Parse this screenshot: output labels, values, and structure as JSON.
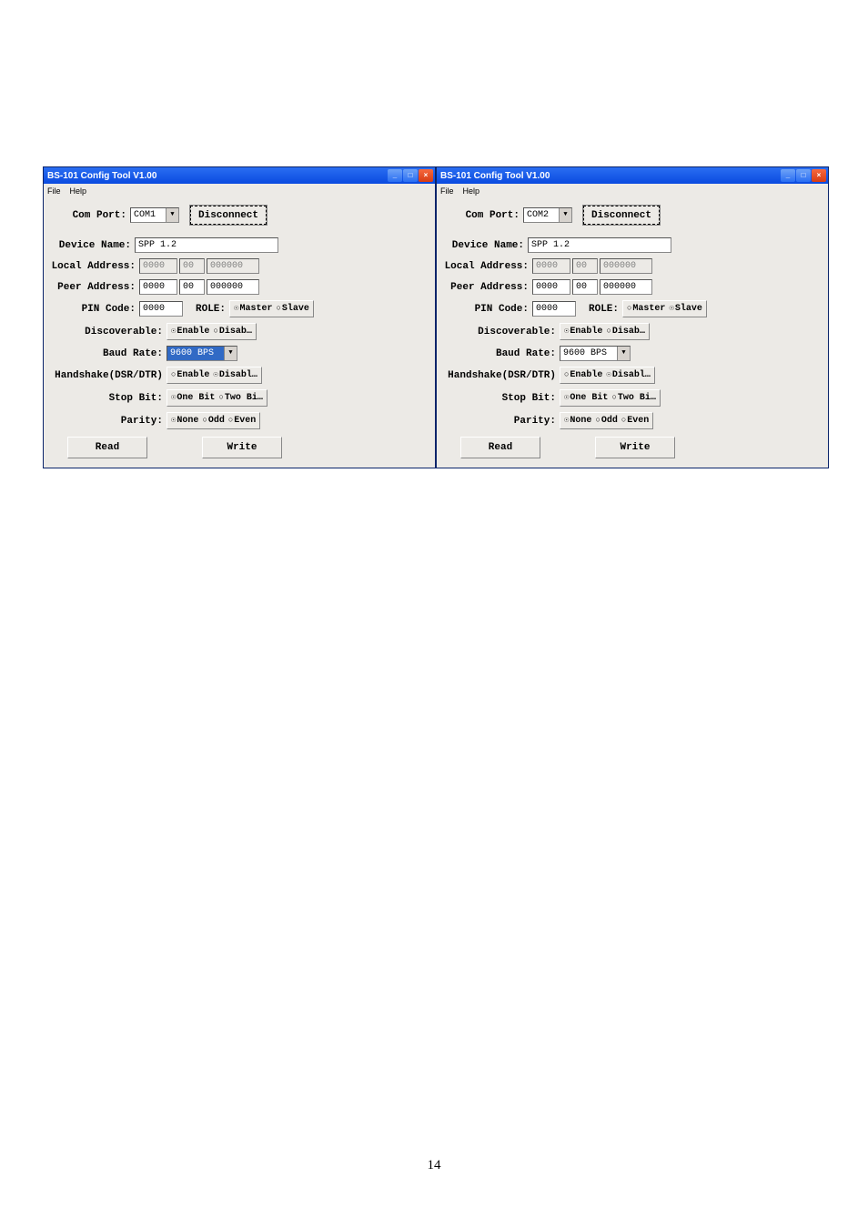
{
  "page_number": "14",
  "windows": [
    {
      "title": "BS-101 Config Tool V1.00",
      "menu": {
        "file": "File",
        "help": "Help"
      },
      "com_port": {
        "label": "Com Port:",
        "value": "COM1",
        "button": "Disconnect"
      },
      "device_name": {
        "label": "Device Name:",
        "value": "SPP 1.2"
      },
      "local_addr": {
        "label": "Local Address:",
        "a": "0000",
        "b": "00",
        "c": "000000"
      },
      "peer_addr": {
        "label": "Peer Address:",
        "a": "0000",
        "b": "00",
        "c": "000000"
      },
      "pin": {
        "label": "PIN Code:",
        "value": "0000"
      },
      "role": {
        "label": "ROLE:",
        "opt1": "Master",
        "opt2": "Slave",
        "selected": 1
      },
      "discoverable": {
        "label": "Discoverable:",
        "opt1": "Enable",
        "opt2": "Disab…",
        "selected": 1
      },
      "baud": {
        "label": "Baud Rate:",
        "value": "9600 BPS",
        "highlight": true
      },
      "handshake": {
        "label": "Handshake(DSR/DTR)",
        "opt1": "Enable",
        "opt2": "Disabl…",
        "selected": 2
      },
      "stopbit": {
        "label": "Stop Bit:",
        "opt1": "One Bit",
        "opt2": "Two Bi…",
        "selected": 1
      },
      "parity": {
        "label": "Parity:",
        "opt1": "None",
        "opt2": "Odd",
        "opt3": "Even",
        "selected": 1
      },
      "read_btn": "Read",
      "write_btn": "Write"
    },
    {
      "title": "BS-101 Config Tool V1.00",
      "menu": {
        "file": "File",
        "help": "Help"
      },
      "com_port": {
        "label": "Com Port:",
        "value": "COM2",
        "button": "Disconnect"
      },
      "device_name": {
        "label": "Device Name:",
        "value": "SPP 1.2"
      },
      "local_addr": {
        "label": "Local Address:",
        "a": "0000",
        "b": "00",
        "c": "000000"
      },
      "peer_addr": {
        "label": "Peer Address:",
        "a": "0000",
        "b": "00",
        "c": "000000"
      },
      "pin": {
        "label": "PIN Code:",
        "value": "0000"
      },
      "role": {
        "label": "ROLE:",
        "opt1": "Master",
        "opt2": "Slave",
        "selected": 2
      },
      "discoverable": {
        "label": "Discoverable:",
        "opt1": "Enable",
        "opt2": "Disab…",
        "selected": 1
      },
      "baud": {
        "label": "Baud Rate:",
        "value": "9600 BPS",
        "highlight": false
      },
      "handshake": {
        "label": "Handshake(DSR/DTR)",
        "opt1": "Enable",
        "opt2": "Disabl…",
        "selected": 2
      },
      "stopbit": {
        "label": "Stop Bit:",
        "opt1": "One Bit",
        "opt2": "Two Bi…",
        "selected": 1
      },
      "parity": {
        "label": "Parity:",
        "opt1": "None",
        "opt2": "Odd",
        "opt3": "Even",
        "selected": 1
      },
      "read_btn": "Read",
      "write_btn": "Write"
    }
  ]
}
